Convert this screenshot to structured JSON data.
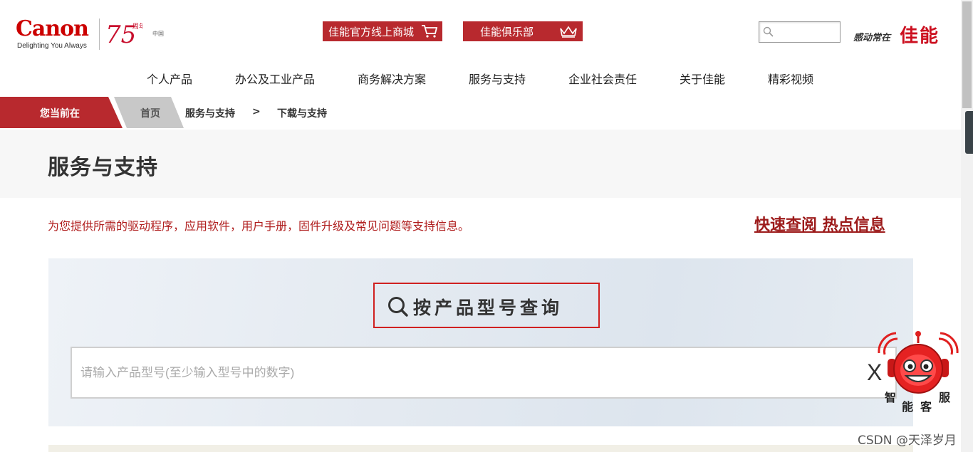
{
  "logo": {
    "wordmark": "Canon",
    "tagline": "Delighting You Always",
    "anniversary": "75",
    "anniversary_cn": "周年",
    "region": "中国"
  },
  "header": {
    "shop_button": "佳能官方线上商城",
    "club_button": "佳能俱乐部",
    "search_placeholder": "",
    "slogan_small": "感动常在",
    "slogan_big": "佳能"
  },
  "nav": {
    "items": [
      "个人产品",
      "办公及工业产品",
      "商务解决方案",
      "服务与支持",
      "企业社会责任",
      "关于佳能",
      "精彩视频"
    ]
  },
  "breadcrumb": {
    "here_label": "您当前在",
    "home": "首页",
    "level1": "服务与支持",
    "separator": ">",
    "level2": "下载与支持"
  },
  "page": {
    "title": "服务与支持",
    "description": "为您提供所需的驱动程序，应用软件，用户手册，固件升级及常见问题等支持信息。",
    "hot_link": "快速查阅 热点信息"
  },
  "search_panel": {
    "query_label": "按产品型号查询",
    "input_placeholder": "请输入产品型号(至少输入型号中的数字)",
    "input_value": "",
    "clear_label": "X"
  },
  "assistant": {
    "chars": [
      "智",
      "能",
      "客",
      "服"
    ]
  },
  "watermark": "CSDN @天泽岁月",
  "colors": {
    "brand_red": "#b8292e",
    "canon_red": "#cc0000",
    "breadcrumb_gray": "#c8c8c8"
  }
}
